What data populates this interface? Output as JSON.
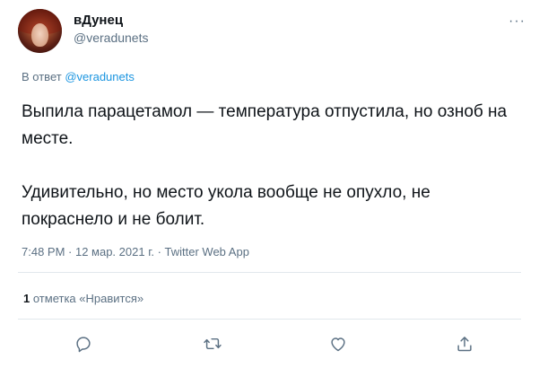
{
  "tweet": {
    "author_name": "вДунец",
    "author_handle": "@veradunets",
    "reply_prefix": "В ответ",
    "reply_mention": "@veradunets",
    "paragraphs": [
      "Выпила парацетамол — температура отпустила, но озноб на месте.",
      "Удивительно, но место укола вообще не опухло, не покраснело и не болит."
    ],
    "meta": "7:48 PM · 12 мар. 2021 г. · Twitter Web App",
    "likes_count": "1",
    "likes_label": "отметка «Нравится»"
  },
  "actions": [
    {
      "icon": "reply-icon"
    },
    {
      "icon": "retweet-icon"
    },
    {
      "icon": "like-icon"
    },
    {
      "icon": "share-icon"
    }
  ],
  "colors": {
    "text": "#0f1419",
    "secondary": "#5b7083",
    "link": "#1b95e0",
    "divider": "#e1e8ed"
  }
}
